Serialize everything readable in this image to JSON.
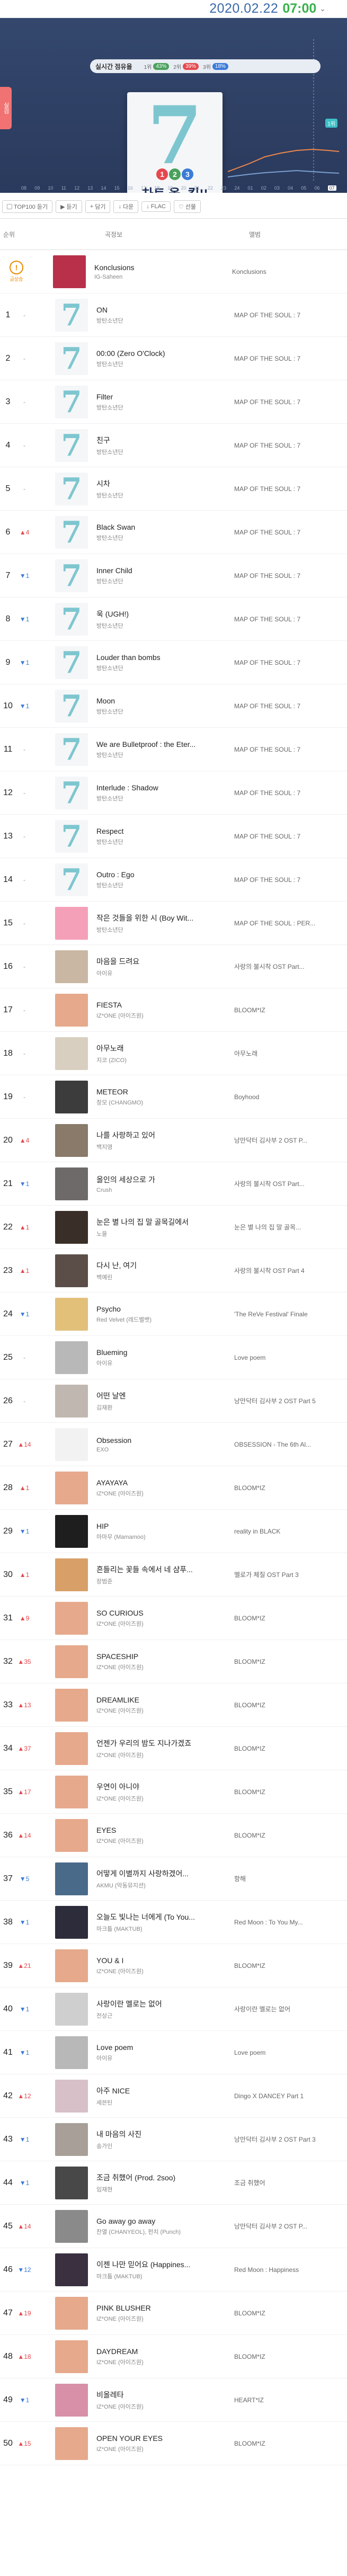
{
  "header": {
    "date": "2020.02.22",
    "time": "07:00",
    "caret": "⌄"
  },
  "hero": {
    "legend_label": "실시간 점유율",
    "legend": [
      {
        "rank": "1위",
        "pct": "43%",
        "color": "#4aa05c"
      },
      {
        "rank": "2위",
        "pct": "39%",
        "color": "#e5484d"
      },
      {
        "rank": "3위",
        "pct": "18%",
        "color": "#3b7bd9"
      }
    ],
    "left_badge": "실검",
    "right_label": "1위",
    "album_numbers": [
      "1",
      "2",
      "3"
    ],
    "album_tag": "차트 올~킬!!",
    "axis": [
      "08",
      "09",
      "10",
      "11",
      "12",
      "13",
      "14",
      "15",
      "16",
      "17",
      "18",
      "19",
      "20",
      "21",
      "22",
      "23",
      "24",
      "01",
      "02",
      "03",
      "04",
      "05",
      "06",
      "07"
    ],
    "axis_current": "07"
  },
  "toolbar": {
    "buttons": [
      "TOP100 듣기",
      "듣기",
      "담기",
      "다운",
      "FLAC",
      "선물"
    ]
  },
  "table": {
    "col_rank": "순위",
    "col_song": "곡정보",
    "col_album": "앨범"
  },
  "special": {
    "badge": "!",
    "sub": "급상승",
    "title": "Konclusions",
    "artist": "IG-Saheen",
    "album": "Konclusions"
  },
  "rows": [
    {
      "rank": "1",
      "change": "-",
      "ctype": "same",
      "title": "ON",
      "artist": "방탄소년단",
      "album": "MAP OF THE SOUL : 7",
      "cover": "seven"
    },
    {
      "rank": "2",
      "change": "-",
      "ctype": "same",
      "title": "00:00 (Zero O'Clock)",
      "artist": "방탄소년단",
      "album": "MAP OF THE SOUL : 7",
      "cover": "seven"
    },
    {
      "rank": "3",
      "change": "-",
      "ctype": "same",
      "title": "Filter",
      "artist": "방탄소년단",
      "album": "MAP OF THE SOUL : 7",
      "cover": "seven"
    },
    {
      "rank": "4",
      "change": "-",
      "ctype": "same",
      "title": "친구",
      "artist": "방탄소년단",
      "album": "MAP OF THE SOUL : 7",
      "cover": "seven"
    },
    {
      "rank": "5",
      "change": "-",
      "ctype": "same",
      "title": "시차",
      "artist": "방탄소년단",
      "album": "MAP OF THE SOUL : 7",
      "cover": "seven"
    },
    {
      "rank": "6",
      "change": "▲4",
      "ctype": "up",
      "title": "Black Swan",
      "artist": "방탄소년단",
      "album": "MAP OF THE SOUL : 7",
      "cover": "seven"
    },
    {
      "rank": "7",
      "change": "▼1",
      "ctype": "down",
      "title": "Inner Child",
      "artist": "방탄소년단",
      "album": "MAP OF THE SOUL : 7",
      "cover": "seven"
    },
    {
      "rank": "8",
      "change": "▼1",
      "ctype": "down",
      "title": "욱 (UGH!)",
      "artist": "방탄소년단",
      "album": "MAP OF THE SOUL : 7",
      "cover": "seven"
    },
    {
      "rank": "9",
      "change": "▼1",
      "ctype": "down",
      "title": "Louder than bombs",
      "artist": "방탄소년단",
      "album": "MAP OF THE SOUL : 7",
      "cover": "seven"
    },
    {
      "rank": "10",
      "change": "▼1",
      "ctype": "down",
      "title": "Moon",
      "artist": "방탄소년단",
      "album": "MAP OF THE SOUL : 7",
      "cover": "seven"
    },
    {
      "rank": "11",
      "change": "-",
      "ctype": "same",
      "title": "We are Bulletproof : the Eter...",
      "artist": "방탄소년단",
      "album": "MAP OF THE SOUL : 7",
      "cover": "seven"
    },
    {
      "rank": "12",
      "change": "-",
      "ctype": "same",
      "title": "Interlude : Shadow",
      "artist": "방탄소년단",
      "album": "MAP OF THE SOUL : 7",
      "cover": "seven"
    },
    {
      "rank": "13",
      "change": "-",
      "ctype": "same",
      "title": "Respect",
      "artist": "방탄소년단",
      "album": "MAP OF THE SOUL : 7",
      "cover": "seven"
    },
    {
      "rank": "14",
      "change": "-",
      "ctype": "same",
      "title": "Outro : Ego",
      "artist": "방탄소년단",
      "album": "MAP OF THE SOUL : 7",
      "cover": "seven"
    },
    {
      "rank": "15",
      "change": "-",
      "ctype": "same",
      "title": "작은 것들을 위한 시 (Boy Wit...",
      "artist": "방탄소년단",
      "album": "MAP OF THE SOUL : PER...",
      "cover": "#f4a0b8"
    },
    {
      "rank": "16",
      "change": "-",
      "ctype": "same",
      "title": "마음을 드려요",
      "artist": "아이유",
      "album": "사랑의 불시착 OST Part...",
      "cover": "#c9b7a3"
    },
    {
      "rank": "17",
      "change": "-",
      "ctype": "same",
      "title": "FIESTA",
      "artist": "IZ*ONE (아이즈원)",
      "album": "BLOOM*IZ",
      "cover": "#e6a98c"
    },
    {
      "rank": "18",
      "change": "-",
      "ctype": "same",
      "title": "아무노래",
      "artist": "지코 (ZICO)",
      "album": "아무노래",
      "cover": "#d8cfc0"
    },
    {
      "rank": "19",
      "change": "-",
      "ctype": "same",
      "title": "METEOR",
      "artist": "창모 (CHANGMO)",
      "album": "Boyhood",
      "cover": "#3c3c3c"
    },
    {
      "rank": "20",
      "change": "▲4",
      "ctype": "up",
      "title": "나를 사랑하고 있어",
      "artist": "백지영",
      "album": "낭만닥터 김사부 2 OST P...",
      "cover": "#8a7a6a"
    },
    {
      "rank": "21",
      "change": "▼1",
      "ctype": "down",
      "title": "올인의 세상으로 가",
      "artist": "Crush",
      "album": "사랑의 불시착 OST Part...",
      "cover": "#6f6a6a"
    },
    {
      "rank": "22",
      "change": "▲1",
      "ctype": "up",
      "title": "눈은 별 나의 집 말 골목길에서",
      "artist": "노을",
      "album": "눈은 별 나의 집 말 골목...",
      "cover": "#3a2e28"
    },
    {
      "rank": "23",
      "change": "▲1",
      "ctype": "up",
      "title": "다시 난, 여기",
      "artist": "백예린",
      "album": "사랑의 불시착 OST Part 4",
      "cover": "#5b4e48"
    },
    {
      "rank": "24",
      "change": "▼1",
      "ctype": "down",
      "title": "Psycho",
      "artist": "Red Velvet (레드벨벳)",
      "album": "'The ReVe Festival' Finale",
      "cover": "#e2c07a"
    },
    {
      "rank": "25",
      "change": "-",
      "ctype": "same",
      "title": "Blueming",
      "artist": "아이유",
      "album": "Love poem",
      "cover": "#b8b8b8"
    },
    {
      "rank": "26",
      "change": "-",
      "ctype": "same",
      "title": "어떤 날엔",
      "artist": "김재환",
      "album": "낭만닥터 김사부 2 OST Part 5",
      "cover": "#c0b8b0"
    },
    {
      "rank": "27",
      "change": "▲14",
      "ctype": "up",
      "title": "Obsession",
      "artist": "EXO",
      "album": "OBSESSION - The 6th Al...",
      "cover": "#f2f2f2"
    },
    {
      "rank": "28",
      "change": "▲1",
      "ctype": "up",
      "title": "AYAYAYA",
      "artist": "IZ*ONE (아이즈원)",
      "album": "BLOOM*IZ",
      "cover": "#e6a98c"
    },
    {
      "rank": "29",
      "change": "▼1",
      "ctype": "down",
      "title": "HIP",
      "artist": "마마무 (Mamamoo)",
      "album": "reality in BLACK",
      "cover": "#1e1e1e"
    },
    {
      "rank": "30",
      "change": "▲1",
      "ctype": "up",
      "title": "흔들리는 꽃들 속에서 네 샴푸...",
      "artist": "장범준",
      "album": "멜로가 체질 OST Part 3",
      "cover": "#d8a068"
    },
    {
      "rank": "31",
      "change": "▲9",
      "ctype": "up",
      "title": "SO CURIOUS",
      "artist": "IZ*ONE (아이즈원)",
      "album": "BLOOM*IZ",
      "cover": "#e6a98c"
    },
    {
      "rank": "32",
      "change": "▲35",
      "ctype": "up",
      "title": "SPACESHIP",
      "artist": "IZ*ONE (아이즈원)",
      "album": "BLOOM*IZ",
      "cover": "#e6a98c"
    },
    {
      "rank": "33",
      "change": "▲13",
      "ctype": "up",
      "title": "DREAMLIKE",
      "artist": "IZ*ONE (아이즈원)",
      "album": "BLOOM*IZ",
      "cover": "#e6a98c"
    },
    {
      "rank": "34",
      "change": "▲37",
      "ctype": "up",
      "title": "언젠가 우리의 밤도 지나가겠죠",
      "artist": "IZ*ONE (아이즈원)",
      "album": "BLOOM*IZ",
      "cover": "#e6a98c"
    },
    {
      "rank": "35",
      "change": "▲17",
      "ctype": "up",
      "title": "우연이 아니야",
      "artist": "IZ*ONE (아이즈원)",
      "album": "BLOOM*IZ",
      "cover": "#e6a98c"
    },
    {
      "rank": "36",
      "change": "▲14",
      "ctype": "up",
      "title": "EYES",
      "artist": "IZ*ONE (아이즈원)",
      "album": "BLOOM*IZ",
      "cover": "#e6a98c"
    },
    {
      "rank": "37",
      "change": "▼5",
      "ctype": "down",
      "title": "어떻게 이별까지 사랑하겠어...",
      "artist": "AKMU (악동뮤지션)",
      "album": "항해",
      "cover": "#4a6a8a"
    },
    {
      "rank": "38",
      "change": "▼1",
      "ctype": "down",
      "title": "오늘도 빛나는 너에게 (To You...",
      "artist": "마크툽 (MAKTUB)",
      "album": "Red Moon : To You My...",
      "cover": "#2c2c3a"
    },
    {
      "rank": "39",
      "change": "▲21",
      "ctype": "up",
      "title": "YOU & I",
      "artist": "IZ*ONE (아이즈원)",
      "album": "BLOOM*IZ",
      "cover": "#e6a98c"
    },
    {
      "rank": "40",
      "change": "▼1",
      "ctype": "down",
      "title": "사랑이란 멜로는 없어",
      "artist": "전상근",
      "album": "사랑이란 멜로는 없어",
      "cover": "#cfcfcf"
    },
    {
      "rank": "41",
      "change": "▼1",
      "ctype": "down",
      "title": "Love poem",
      "artist": "아이유",
      "album": "Love poem",
      "cover": "#b8b8b8"
    },
    {
      "rank": "42",
      "change": "▲12",
      "ctype": "up",
      "title": "아주 NICE",
      "artist": "세븐틴",
      "album": "Dingo X DANCEY Part 1",
      "cover": "#d8c0c8"
    },
    {
      "rank": "43",
      "change": "▼1",
      "ctype": "down",
      "title": "내 마음의 사진",
      "artist": "송가인",
      "album": "낭만닥터 김사부 2 OST Part 3",
      "cover": "#a8a098"
    },
    {
      "rank": "44",
      "change": "▼1",
      "ctype": "down",
      "title": "조금 취했어 (Prod. 2soo)",
      "artist": "임재현",
      "album": "조금 취했어",
      "cover": "#484848"
    },
    {
      "rank": "45",
      "change": "▲14",
      "ctype": "up",
      "title": "Go away go away",
      "artist": "찬열 (CHANYEOL), 펀치 (Punch)",
      "album": "낭만닥터 김사부 2 OST P...",
      "cover": "#8a8a8a"
    },
    {
      "rank": "46",
      "change": "▼12",
      "ctype": "down",
      "title": "이젠 나만 믿어요 (Happines...",
      "artist": "마크툽 (MAKTUB)",
      "album": "Red Moon : Happiness",
      "cover": "#3a3040"
    },
    {
      "rank": "47",
      "change": "▲19",
      "ctype": "up",
      "title": "PINK BLUSHER",
      "artist": "IZ*ONE (아이즈원)",
      "album": "BLOOM*IZ",
      "cover": "#e6a98c"
    },
    {
      "rank": "48",
      "change": "▲18",
      "ctype": "up",
      "title": "DAYDREAM",
      "artist": "IZ*ONE (아이즈원)",
      "album": "BLOOM*IZ",
      "cover": "#e6a98c"
    },
    {
      "rank": "49",
      "change": "▼1",
      "ctype": "down",
      "title": "비올레타",
      "artist": "IZ*ONE (아이즈원)",
      "album": "HEART*IZ",
      "cover": "#d890a8"
    },
    {
      "rank": "50",
      "change": "▲15",
      "ctype": "up",
      "title": "OPEN YOUR EYES",
      "artist": "IZ*ONE (아이즈원)",
      "album": "BLOOM*IZ",
      "cover": "#e6a98c"
    }
  ]
}
